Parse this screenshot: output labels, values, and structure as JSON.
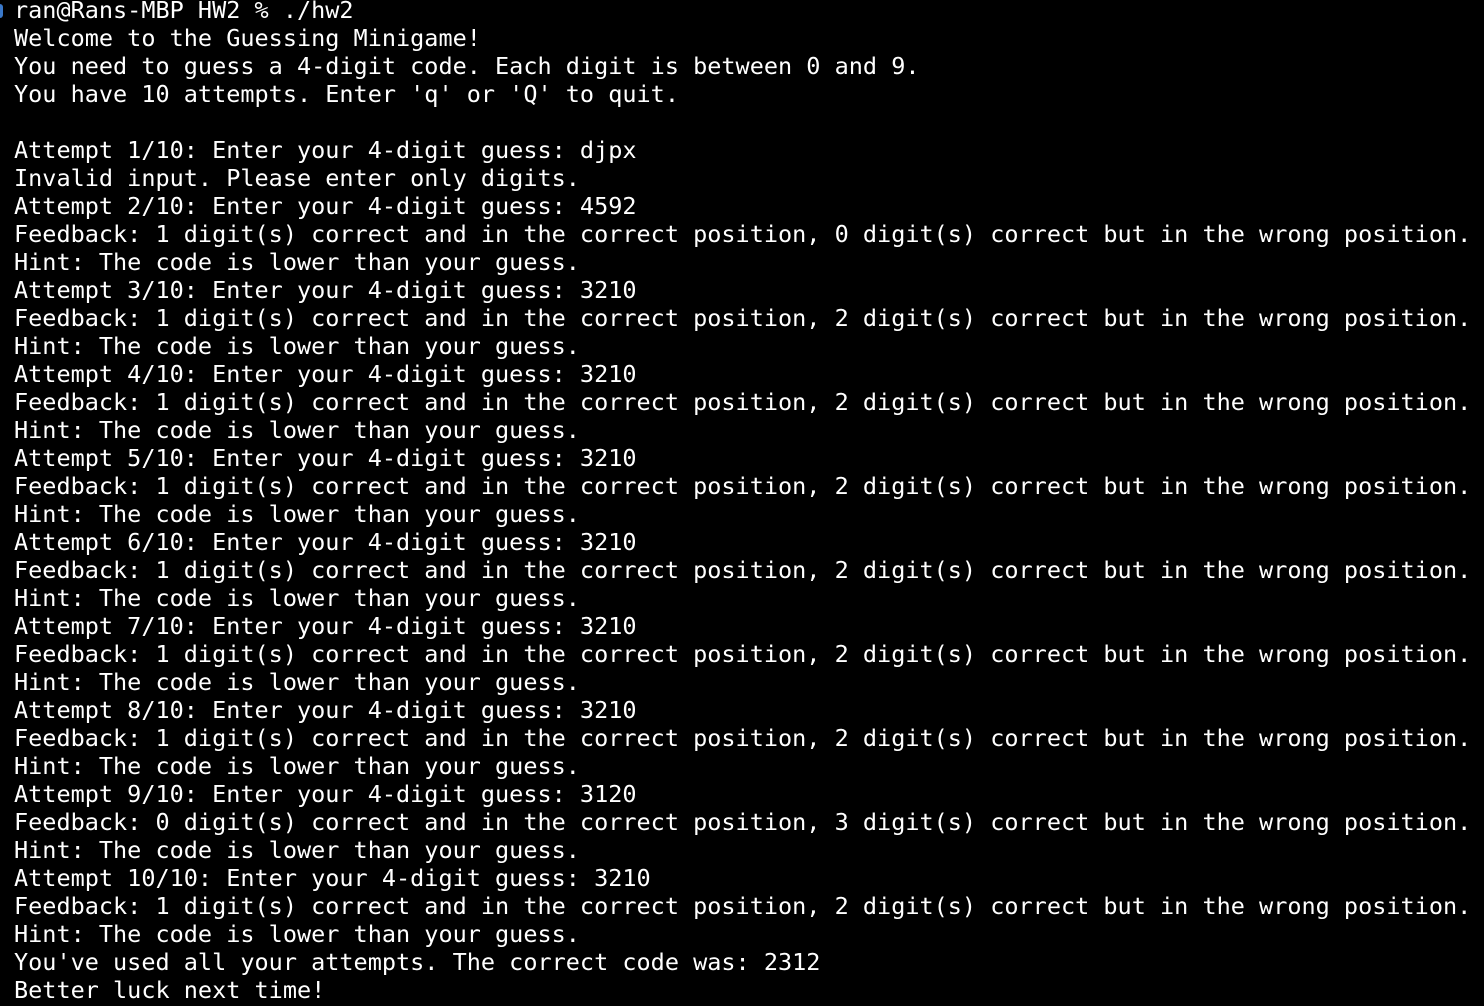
{
  "terminal": {
    "prompt": "ran@Rans-MBP HW2 % ./hw2",
    "lines": [
      "Welcome to the Guessing Minigame!",
      "You need to guess a 4-digit code. Each digit is between 0 and 9.",
      "You have 10 attempts. Enter 'q' or 'Q' to quit.",
      "",
      "Attempt 1/10: Enter your 4-digit guess: djpx",
      "Invalid input. Please enter only digits.",
      "Attempt 2/10: Enter your 4-digit guess: 4592",
      "Feedback: 1 digit(s) correct and in the correct position, 0 digit(s) correct but in the wrong position.",
      "Hint: The code is lower than your guess.",
      "Attempt 3/10: Enter your 4-digit guess: 3210",
      "Feedback: 1 digit(s) correct and in the correct position, 2 digit(s) correct but in the wrong position.",
      "Hint: The code is lower than your guess.",
      "Attempt 4/10: Enter your 4-digit guess: 3210",
      "Feedback: 1 digit(s) correct and in the correct position, 2 digit(s) correct but in the wrong position.",
      "Hint: The code is lower than your guess.",
      "Attempt 5/10: Enter your 4-digit guess: 3210",
      "Feedback: 1 digit(s) correct and in the correct position, 2 digit(s) correct but in the wrong position.",
      "Hint: The code is lower than your guess.",
      "Attempt 6/10: Enter your 4-digit guess: 3210",
      "Feedback: 1 digit(s) correct and in the correct position, 2 digit(s) correct but in the wrong position.",
      "Hint: The code is lower than your guess.",
      "Attempt 7/10: Enter your 4-digit guess: 3210",
      "Feedback: 1 digit(s) correct and in the correct position, 2 digit(s) correct but in the wrong position.",
      "Hint: The code is lower than your guess.",
      "Attempt 8/10: Enter your 4-digit guess: 3210",
      "Feedback: 1 digit(s) correct and in the correct position, 2 digit(s) correct but in the wrong position.",
      "Hint: The code is lower than your guess.",
      "Attempt 9/10: Enter your 4-digit guess: 3120",
      "Feedback: 0 digit(s) correct and in the correct position, 3 digit(s) correct but in the wrong position.",
      "Hint: The code is lower than your guess.",
      "Attempt 10/10: Enter your 4-digit guess: 3210",
      "Feedback: 1 digit(s) correct and in the correct position, 2 digit(s) correct but in the wrong position.",
      "Hint: The code is lower than your guess.",
      "You've used all your attempts. The correct code was: 2312",
      "Better luck next time!"
    ]
  },
  "colors": {
    "background": "#000000",
    "text": "#ffffff",
    "prompt_marker": "#3a78c9"
  }
}
